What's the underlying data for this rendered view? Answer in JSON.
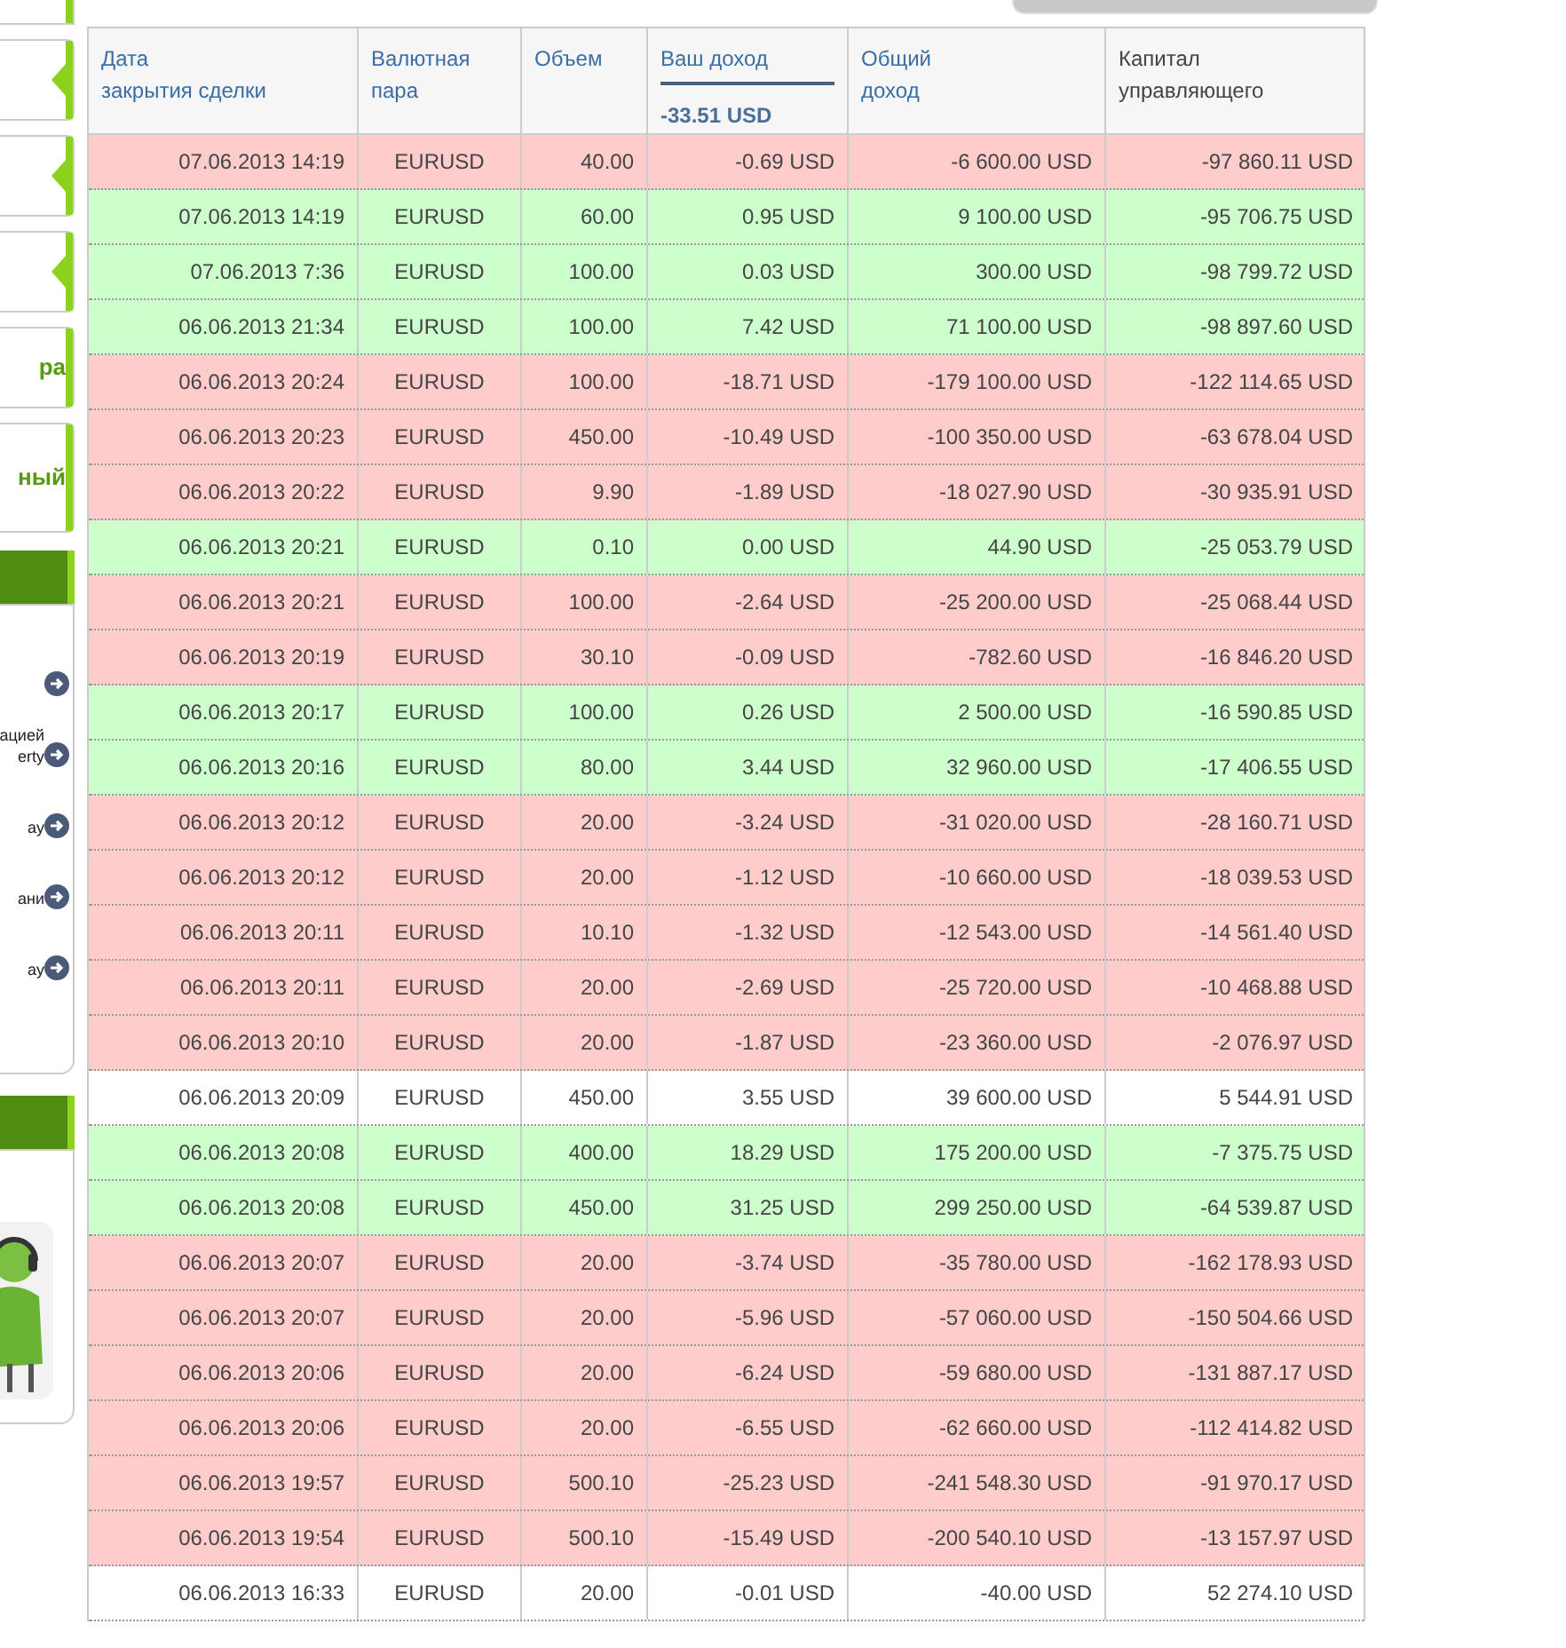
{
  "sidebar": {
    "items": [
      {
        "kind": "notch"
      },
      {
        "kind": "notch"
      },
      {
        "kind": "notch"
      },
      {
        "kind": "label",
        "label": "ра"
      },
      {
        "kind": "label",
        "label": "ный"
      }
    ],
    "links": [
      {
        "kind": "arrow"
      },
      {
        "kind": "text",
        "lines": [
          "ацией",
          "erty"
        ]
      },
      {
        "kind": "text",
        "lines": [
          "ay"
        ]
      },
      {
        "kind": "text",
        "lines": [
          "ани"
        ]
      },
      {
        "kind": "text",
        "lines": [
          "ay"
        ]
      }
    ]
  },
  "table": {
    "columns": [
      {
        "lines": [
          "Дата",
          "закрытия сделки"
        ]
      },
      {
        "lines": [
          "Валютная",
          "пара"
        ]
      },
      {
        "lines": [
          "Объем"
        ]
      },
      {
        "lines": [
          "Ваш доход"
        ],
        "total": "-33.51 USD"
      },
      {
        "lines": [
          "Общий",
          "доход"
        ]
      },
      {
        "lines": [
          "Капитал",
          "управляющего"
        ]
      }
    ],
    "rows": [
      {
        "color": "#ffcccc",
        "cells": [
          "07.06.2013 14:19",
          "EURUSD",
          "40.00",
          "-0.69 USD",
          "-6 600.00 USD",
          "-97 860.11 USD"
        ]
      },
      {
        "color": "#ccffcc",
        "cells": [
          "07.06.2013 14:19",
          "EURUSD",
          "60.00",
          "0.95 USD",
          "9 100.00 USD",
          "-95 706.75 USD"
        ]
      },
      {
        "color": "#ccffcc",
        "cells": [
          "07.06.2013 7:36",
          "EURUSD",
          "100.00",
          "0.03 USD",
          "300.00 USD",
          "-98 799.72 USD"
        ]
      },
      {
        "color": "#ccffcc",
        "cells": [
          "06.06.2013 21:34",
          "EURUSD",
          "100.00",
          "7.42 USD",
          "71 100.00 USD",
          "-98 897.60 USD"
        ]
      },
      {
        "color": "#ffcccc",
        "cells": [
          "06.06.2013 20:24",
          "EURUSD",
          "100.00",
          "-18.71 USD",
          "-179 100.00 USD",
          "-122 114.65 USD"
        ]
      },
      {
        "color": "#ffcccc",
        "cells": [
          "06.06.2013 20:23",
          "EURUSD",
          "450.00",
          "-10.49 USD",
          "-100 350.00 USD",
          "-63 678.04 USD"
        ]
      },
      {
        "color": "#ffcccc",
        "cells": [
          "06.06.2013 20:22",
          "EURUSD",
          "9.90",
          "-1.89 USD",
          "-18 027.90 USD",
          "-30 935.91 USD"
        ]
      },
      {
        "color": "#ccffcc",
        "cells": [
          "06.06.2013 20:21",
          "EURUSD",
          "0.10",
          "0.00 USD",
          "44.90 USD",
          "-25 053.79 USD"
        ]
      },
      {
        "color": "#ffcccc",
        "cells": [
          "06.06.2013 20:21",
          "EURUSD",
          "100.00",
          "-2.64 USD",
          "-25 200.00 USD",
          "-25 068.44 USD"
        ]
      },
      {
        "color": "#ffcccc",
        "cells": [
          "06.06.2013 20:19",
          "EURUSD",
          "30.10",
          "-0.09 USD",
          "-782.60 USD",
          "-16 846.20 USD"
        ]
      },
      {
        "color": "#ccffcc",
        "cells": [
          "06.06.2013 20:17",
          "EURUSD",
          "100.00",
          "0.26 USD",
          "2 500.00 USD",
          "-16 590.85 USD"
        ]
      },
      {
        "color": "#ccffcc",
        "cells": [
          "06.06.2013 20:16",
          "EURUSD",
          "80.00",
          "3.44 USD",
          "32 960.00 USD",
          "-17 406.55 USD"
        ]
      },
      {
        "color": "#ffcccc",
        "cells": [
          "06.06.2013 20:12",
          "EURUSD",
          "20.00",
          "-3.24 USD",
          "-31 020.00 USD",
          "-28 160.71 USD"
        ]
      },
      {
        "color": "#ffcccc",
        "cells": [
          "06.06.2013 20:12",
          "EURUSD",
          "20.00",
          "-1.12 USD",
          "-10 660.00 USD",
          "-18 039.53 USD"
        ]
      },
      {
        "color": "#ffcccc",
        "cells": [
          "06.06.2013 20:11",
          "EURUSD",
          "10.10",
          "-1.32 USD",
          "-12 543.00 USD",
          "-14 561.40 USD"
        ]
      },
      {
        "color": "#ffcccc",
        "cells": [
          "06.06.2013 20:11",
          "EURUSD",
          "20.00",
          "-2.69 USD",
          "-25 720.00 USD",
          "-10 468.88 USD"
        ]
      },
      {
        "color": "#ffcccc",
        "cells": [
          "06.06.2013 20:10",
          "EURUSD",
          "20.00",
          "-1.87 USD",
          "-23 360.00 USD",
          "-2 076.97 USD"
        ]
      },
      {
        "color": "#ffffff",
        "cells": [
          "06.06.2013 20:09",
          "EURUSD",
          "450.00",
          "3.55 USD",
          "39 600.00 USD",
          "5 544.91 USD"
        ]
      },
      {
        "color": "#ccffcc",
        "cells": [
          "06.06.2013 20:08",
          "EURUSD",
          "400.00",
          "18.29 USD",
          "175 200.00 USD",
          "-7 375.75 USD"
        ]
      },
      {
        "color": "#ccffcc",
        "cells": [
          "06.06.2013 20:08",
          "EURUSD",
          "450.00",
          "31.25 USD",
          "299 250.00 USD",
          "-64 539.87 USD"
        ]
      },
      {
        "color": "#ffcccc",
        "cells": [
          "06.06.2013 20:07",
          "EURUSD",
          "20.00",
          "-3.74 USD",
          "-35 780.00 USD",
          "-162 178.93 USD"
        ]
      },
      {
        "color": "#ffcccc",
        "cells": [
          "06.06.2013 20:07",
          "EURUSD",
          "20.00",
          "-5.96 USD",
          "-57 060.00 USD",
          "-150 504.66 USD"
        ]
      },
      {
        "color": "#ffcccc",
        "cells": [
          "06.06.2013 20:06",
          "EURUSD",
          "20.00",
          "-6.24 USD",
          "-59 680.00 USD",
          "-131 887.17 USD"
        ]
      },
      {
        "color": "#ffcccc",
        "cells": [
          "06.06.2013 20:06",
          "EURUSD",
          "20.00",
          "-6.55 USD",
          "-62 660.00 USD",
          "-112 414.82 USD"
        ]
      },
      {
        "color": "#ffcccc",
        "cells": [
          "06.06.2013 19:57",
          "EURUSD",
          "500.10",
          "-25.23 USD",
          "-241 548.30 USD",
          "-91 970.17 USD"
        ]
      },
      {
        "color": "#ffcccc",
        "cells": [
          "06.06.2013 19:54",
          "EURUSD",
          "500.10",
          "-15.49 USD",
          "-200 540.10 USD",
          "-13 157.97 USD"
        ]
      },
      {
        "color": "#ffffff",
        "cells": [
          "06.06.2013 16:33",
          "EURUSD",
          "20.00",
          "-0.01 USD",
          "-40.00 USD",
          "52 274.10 USD"
        ]
      }
    ]
  }
}
